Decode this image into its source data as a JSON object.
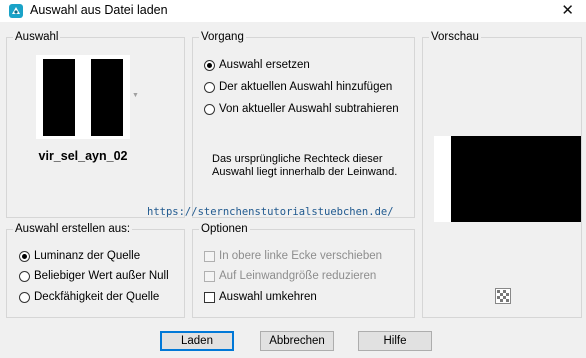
{
  "window": {
    "title": "Auswahl aus Datei laden",
    "close_glyph": "✕",
    "app_icon": "paintshop-icon"
  },
  "auswahl": {
    "label": "Auswahl",
    "selection_name": "vir_sel_ayn_02"
  },
  "vorgang": {
    "label": "Vorgang",
    "options": [
      {
        "label": "Auswahl ersetzen",
        "checked": true
      },
      {
        "label": "Der aktuellen Auswahl hinzufügen",
        "checked": false
      },
      {
        "label": "Von aktueller Auswahl subtrahieren",
        "checked": false
      }
    ],
    "info_text": "Das ursprüngliche Rechteck dieser Auswahl liegt innerhalb der Leinwand."
  },
  "watermark": "https://sternchenstutorialstuebchen.de/",
  "erstellen": {
    "label": "Auswahl erstellen aus:",
    "options": [
      {
        "label": "Luminanz der Quelle",
        "checked": true
      },
      {
        "label": "Beliebiger Wert außer Null",
        "checked": false
      },
      {
        "label": "Deckfähigkeit der Quelle",
        "checked": false
      }
    ]
  },
  "optionen": {
    "label": "Optionen",
    "items": [
      {
        "label": "In obere linke Ecke verschieben",
        "checked": false,
        "disabled": true
      },
      {
        "label": "Auf Leinwandgröße reduzieren",
        "checked": false,
        "disabled": true
      },
      {
        "label": "Auswahl umkehren",
        "checked": false,
        "disabled": false
      }
    ]
  },
  "vorschau": {
    "label": "Vorschau",
    "zoom_icon": "navigation-icon"
  },
  "buttons": {
    "load": "Laden",
    "cancel": "Abbrechen",
    "help": "Hilfe"
  },
  "colors": {
    "accent": "#0078d7",
    "preview_fill": "#000000",
    "watermark": "#215a8f"
  }
}
